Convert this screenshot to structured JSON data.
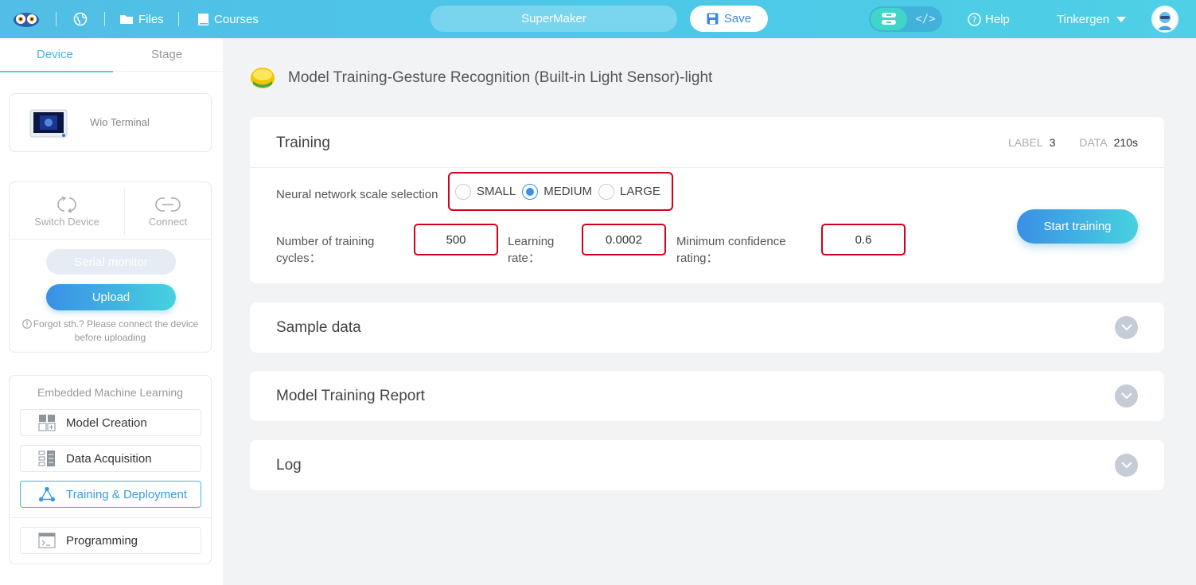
{
  "topbar": {
    "files_label": "Files",
    "courses_label": "Courses",
    "project_name": "SuperMaker",
    "save_label": "Save",
    "code_toggle_label": "</>",
    "help_label": "Help",
    "user_name": "Tinkergen"
  },
  "sidebar": {
    "tabs": [
      {
        "label": "Device",
        "active": true
      },
      {
        "label": "Stage",
        "active": false
      }
    ],
    "device_name": "Wio Terminal",
    "switch_device_label": "Switch Device",
    "connect_label": "Connect",
    "serial_monitor_label": "Serial monitor",
    "upload_label": "Upload",
    "warning_text": "Forgot sth.? Please connect the device before uploading",
    "ml_title": "Embedded Machine Learning",
    "ml_items": [
      {
        "label": "Model Creation",
        "icon": "grid-plus-icon"
      },
      {
        "label": "Data Acquisition",
        "icon": "data-list-icon"
      },
      {
        "label": "Training & Deployment",
        "icon": "network-triangle-icon",
        "active": true
      },
      {
        "label": "Programming",
        "icon": "terminal-icon"
      }
    ]
  },
  "main": {
    "page_title": "Model Training-Gesture Recognition (Built-in Light Sensor)-light",
    "training": {
      "title": "Training",
      "label_key": "LABEL",
      "label_value": "3",
      "data_key": "DATA",
      "data_value": "210s",
      "nn_label": "Neural network scale selection",
      "scale_options": [
        "SMALL",
        "MEDIUM",
        "LARGE"
      ],
      "scale_selected": "MEDIUM",
      "cycles_label": "Number of training cycles：",
      "cycles_value": "500",
      "lr_label": "Learning rate：",
      "lr_value": "0.0002",
      "confidence_label": "Minimum confidence rating：",
      "confidence_value": "0.6",
      "start_label": "Start training"
    },
    "sections": [
      {
        "title": "Sample data"
      },
      {
        "title": "Model Training Report"
      },
      {
        "title": "Log"
      }
    ]
  },
  "colors": {
    "accent": "#3a8fe6",
    "accent2": "#47d2df",
    "highlight_border": "#d0021b",
    "topbar": "#4fc4e7"
  }
}
